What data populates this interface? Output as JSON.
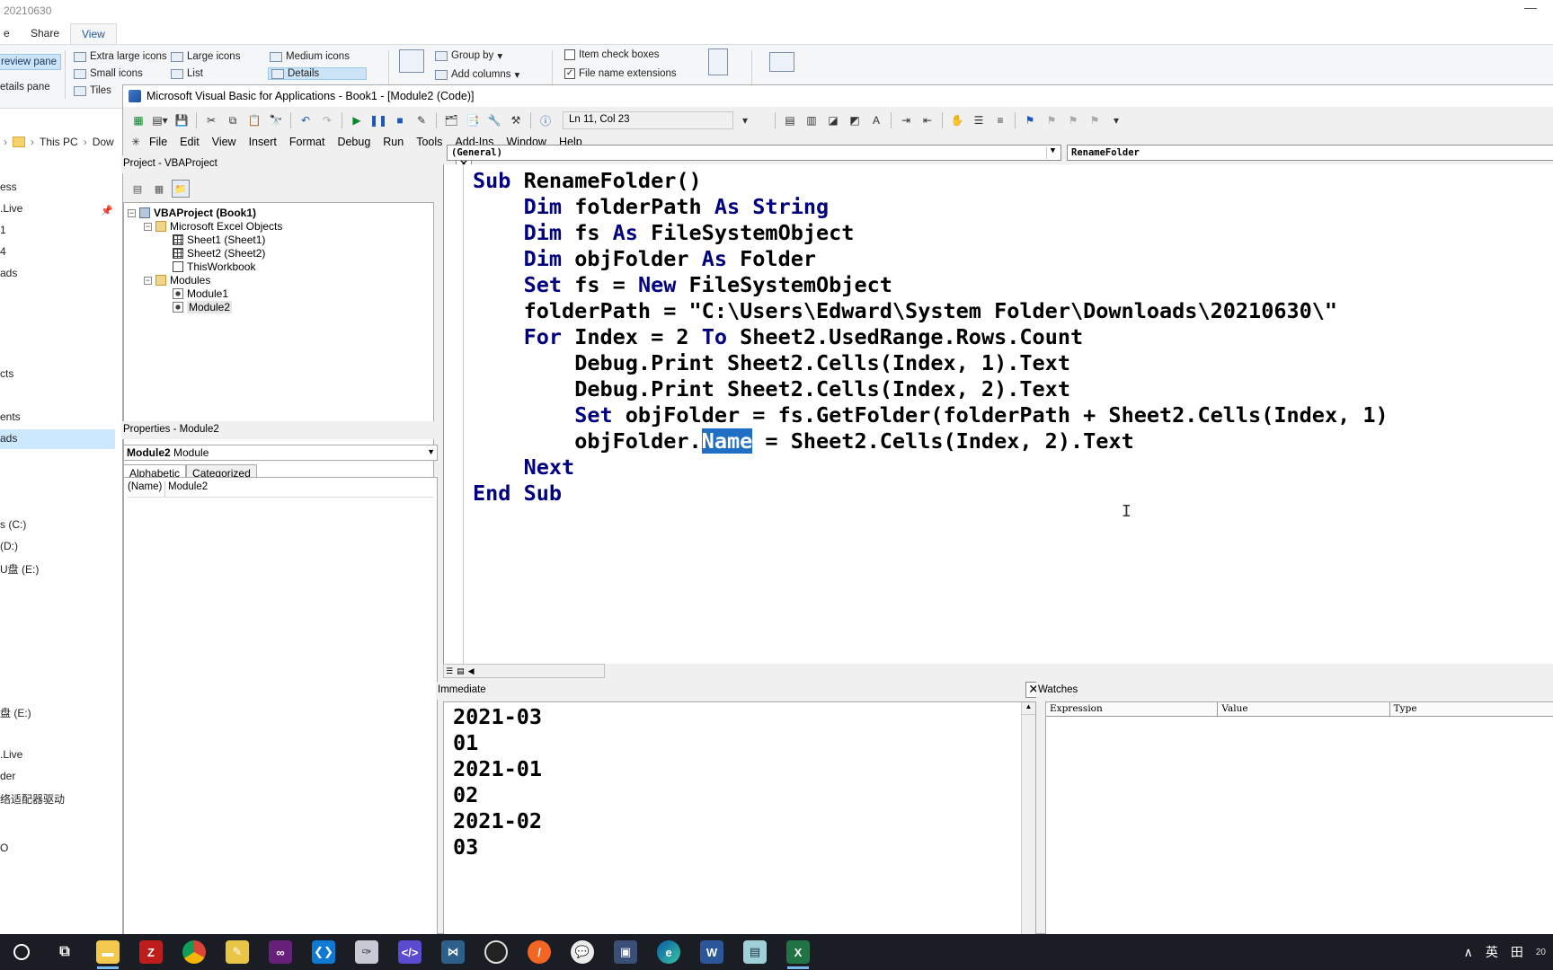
{
  "explorer": {
    "title": "20210630",
    "tabs": [
      "e",
      "Share",
      "View"
    ],
    "ribbon": {
      "preview_pane": "review pane",
      "details_pane": "etails pane",
      "layout": [
        "Extra large icons",
        "Large icons",
        "Medium icons",
        "Small icons",
        "List",
        "Details",
        "Tiles"
      ],
      "group_by": "Group by",
      "add_columns": "Add columns",
      "item_check_boxes": "Item check boxes",
      "file_name_extensions": "File name extensions"
    },
    "address": [
      "This PC",
      "Dow"
    ],
    "nav_items": [
      "ess",
      ".Live",
      "1",
      "4",
      "ads",
      "cts",
      "ents",
      "ads",
      "s (C:)",
      "(D:)",
      "U盘 (E:)",
      "盘 (E:)",
      ".Live",
      "der",
      "络适配器驱动",
      "O"
    ]
  },
  "vba": {
    "title": "Microsoft Visual Basic for Applications - Book1 - [Module2 (Code)]",
    "cursor_pos": "Ln 11, Col 23",
    "menu": [
      "File",
      "Edit",
      "View",
      "Insert",
      "Format",
      "Debug",
      "Run",
      "Tools",
      "Add-Ins",
      "Window",
      "Help"
    ],
    "project": {
      "header": "Project - VBAProject",
      "root": "VBAProject (Book1)",
      "excel_objects": "Microsoft Excel Objects",
      "sheet1": "Sheet1 (Sheet1)",
      "sheet2": "Sheet2 (Sheet2)",
      "this_workbook": "ThisWorkbook",
      "modules": "Modules",
      "module1": "Module1",
      "module2": "Module2"
    },
    "properties": {
      "header": "Properties - Module2",
      "object_name": "Module2",
      "object_type": "Module",
      "tab_alphabetic": "Alphabetic",
      "tab_categorized": "Categorized",
      "prop_key": "(Name)",
      "prop_value": "Module2"
    },
    "code": {
      "object_combo": "(General)",
      "proc_combo": "RenameFolder",
      "line1_kw": "Sub",
      "line1_rest": " RenameFolder()",
      "line2_kw": "Dim",
      "line2_a": " folderPath ",
      "line2_kw2": "As",
      "line2_b": " String",
      "line3_kw": "Dim",
      "line3_a": " fs ",
      "line3_kw2": "As",
      "line3_b": " FileSystemObject",
      "line4_kw": "Dim",
      "line4_a": " objFolder ",
      "line4_kw2": "As",
      "line4_b": " Folder",
      "line5_kw": "Set",
      "line5_a": " fs = ",
      "line5_kw2": "New",
      "line5_b": " FileSystemObject",
      "line6": "folderPath = \"C:\\Users\\Edward\\System Folder\\Downloads\\20210630\\\"",
      "line7_kw": "For",
      "line7_a": " Index = 2 ",
      "line7_kw2": "To",
      "line7_b": " Sheet2.UsedRange.Rows.Count",
      "line8": "Debug.Print Sheet2.Cells(Index, 1).Text",
      "line9": "Debug.Print Sheet2.Cells(Index, 2).Text",
      "line10_kw": "Set",
      "line10_rest": " objFolder = fs.GetFolder(folderPath + Sheet2.Cells(Index, 1)",
      "line11_a": "objFolder.",
      "line11_sel": "Name",
      "line11_b": " = Sheet2.Cells(Index, 2).Text",
      "line12_kw": "Next",
      "line13_kw": "End Sub"
    },
    "immediate": {
      "header": "Immediate",
      "lines": [
        "2021-03",
        "01",
        "2021-01",
        "02",
        "2021-02",
        "03"
      ]
    },
    "watches": {
      "header": "Watches",
      "columns": [
        "Expression",
        "Value",
        "Type"
      ]
    }
  },
  "taskbar": {
    "apps": [
      "search-icon",
      "task-view-icon",
      "file-explorer-icon",
      "filezilla-icon",
      "chrome-icon",
      "notes-icon",
      "visual-studio-icon",
      "vscode-icon",
      "pen-app-icon",
      "code-editor-icon",
      "network-app-icon",
      "obs-icon",
      "orange-app-icon",
      "wechat-icon",
      "remote-desktop-icon",
      "edge-icon",
      "word-icon",
      "notepad-icon",
      "excel-icon"
    ],
    "ime": "英",
    "ime2": "田",
    "date_partial": "20"
  }
}
